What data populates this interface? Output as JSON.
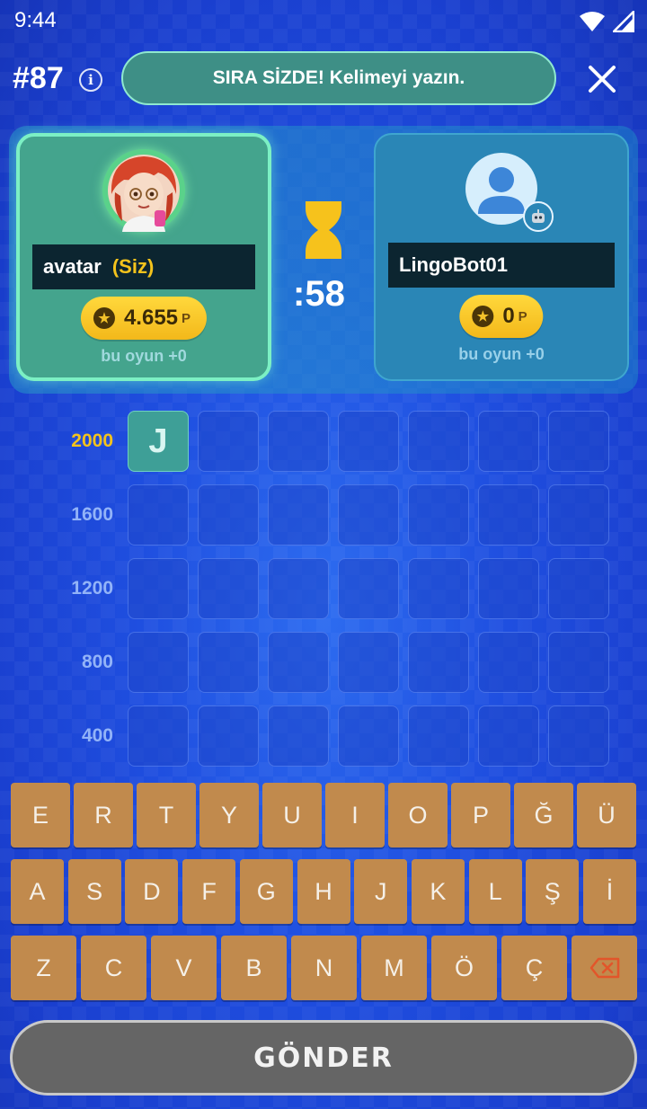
{
  "status_bar": {
    "time": "9:44",
    "icons": [
      "wifi-icon",
      "cellular-signal-icon"
    ]
  },
  "header": {
    "game_number": "#87",
    "info_icon": "info-icon",
    "turn_message": "SIRA SİZDE! Kelimeyi yazın.",
    "close_icon": "close-icon"
  },
  "players": {
    "self": {
      "name": "avatar",
      "tag": "(Siz)",
      "points": "4.655",
      "unit": "P",
      "round_gain": "bu oyun +0"
    },
    "opponent": {
      "name": "LingoBot01",
      "points": "0",
      "unit": "P",
      "round_gain": "bu oyun +0",
      "badge_icon": "robot-icon"
    }
  },
  "timer": {
    "value": ":58",
    "icon": "hourglass-icon"
  },
  "board": {
    "rows": [
      {
        "score": "2000",
        "letters": [
          "J",
          "",
          "",
          "",
          "",
          "",
          ""
        ]
      },
      {
        "score": "1600",
        "letters": [
          "",
          "",
          "",
          "",
          "",
          "",
          ""
        ]
      },
      {
        "score": "1200",
        "letters": [
          "",
          "",
          "",
          "",
          "",
          "",
          ""
        ]
      },
      {
        "score": "800",
        "letters": [
          "",
          "",
          "",
          "",
          "",
          "",
          ""
        ]
      },
      {
        "score": "400",
        "letters": [
          "",
          "",
          "",
          "",
          "",
          "",
          ""
        ]
      }
    ]
  },
  "keyboard": {
    "row1": [
      "E",
      "R",
      "T",
      "Y",
      "U",
      "I",
      "O",
      "P",
      "Ğ",
      "Ü"
    ],
    "row2": [
      "A",
      "S",
      "D",
      "F",
      "G",
      "H",
      "J",
      "K",
      "L",
      "Ş",
      "İ"
    ],
    "row3": [
      "Z",
      "C",
      "V",
      "B",
      "N",
      "M",
      "Ö",
      "Ç"
    ],
    "backspace_icon": "backspace-icon"
  },
  "send_label": "GÖNDER",
  "colors": {
    "accent_gold": "#f4c31c",
    "key": "#c18a4d",
    "self_card": "#44a48d",
    "opponent_card": "#2a86b6"
  }
}
